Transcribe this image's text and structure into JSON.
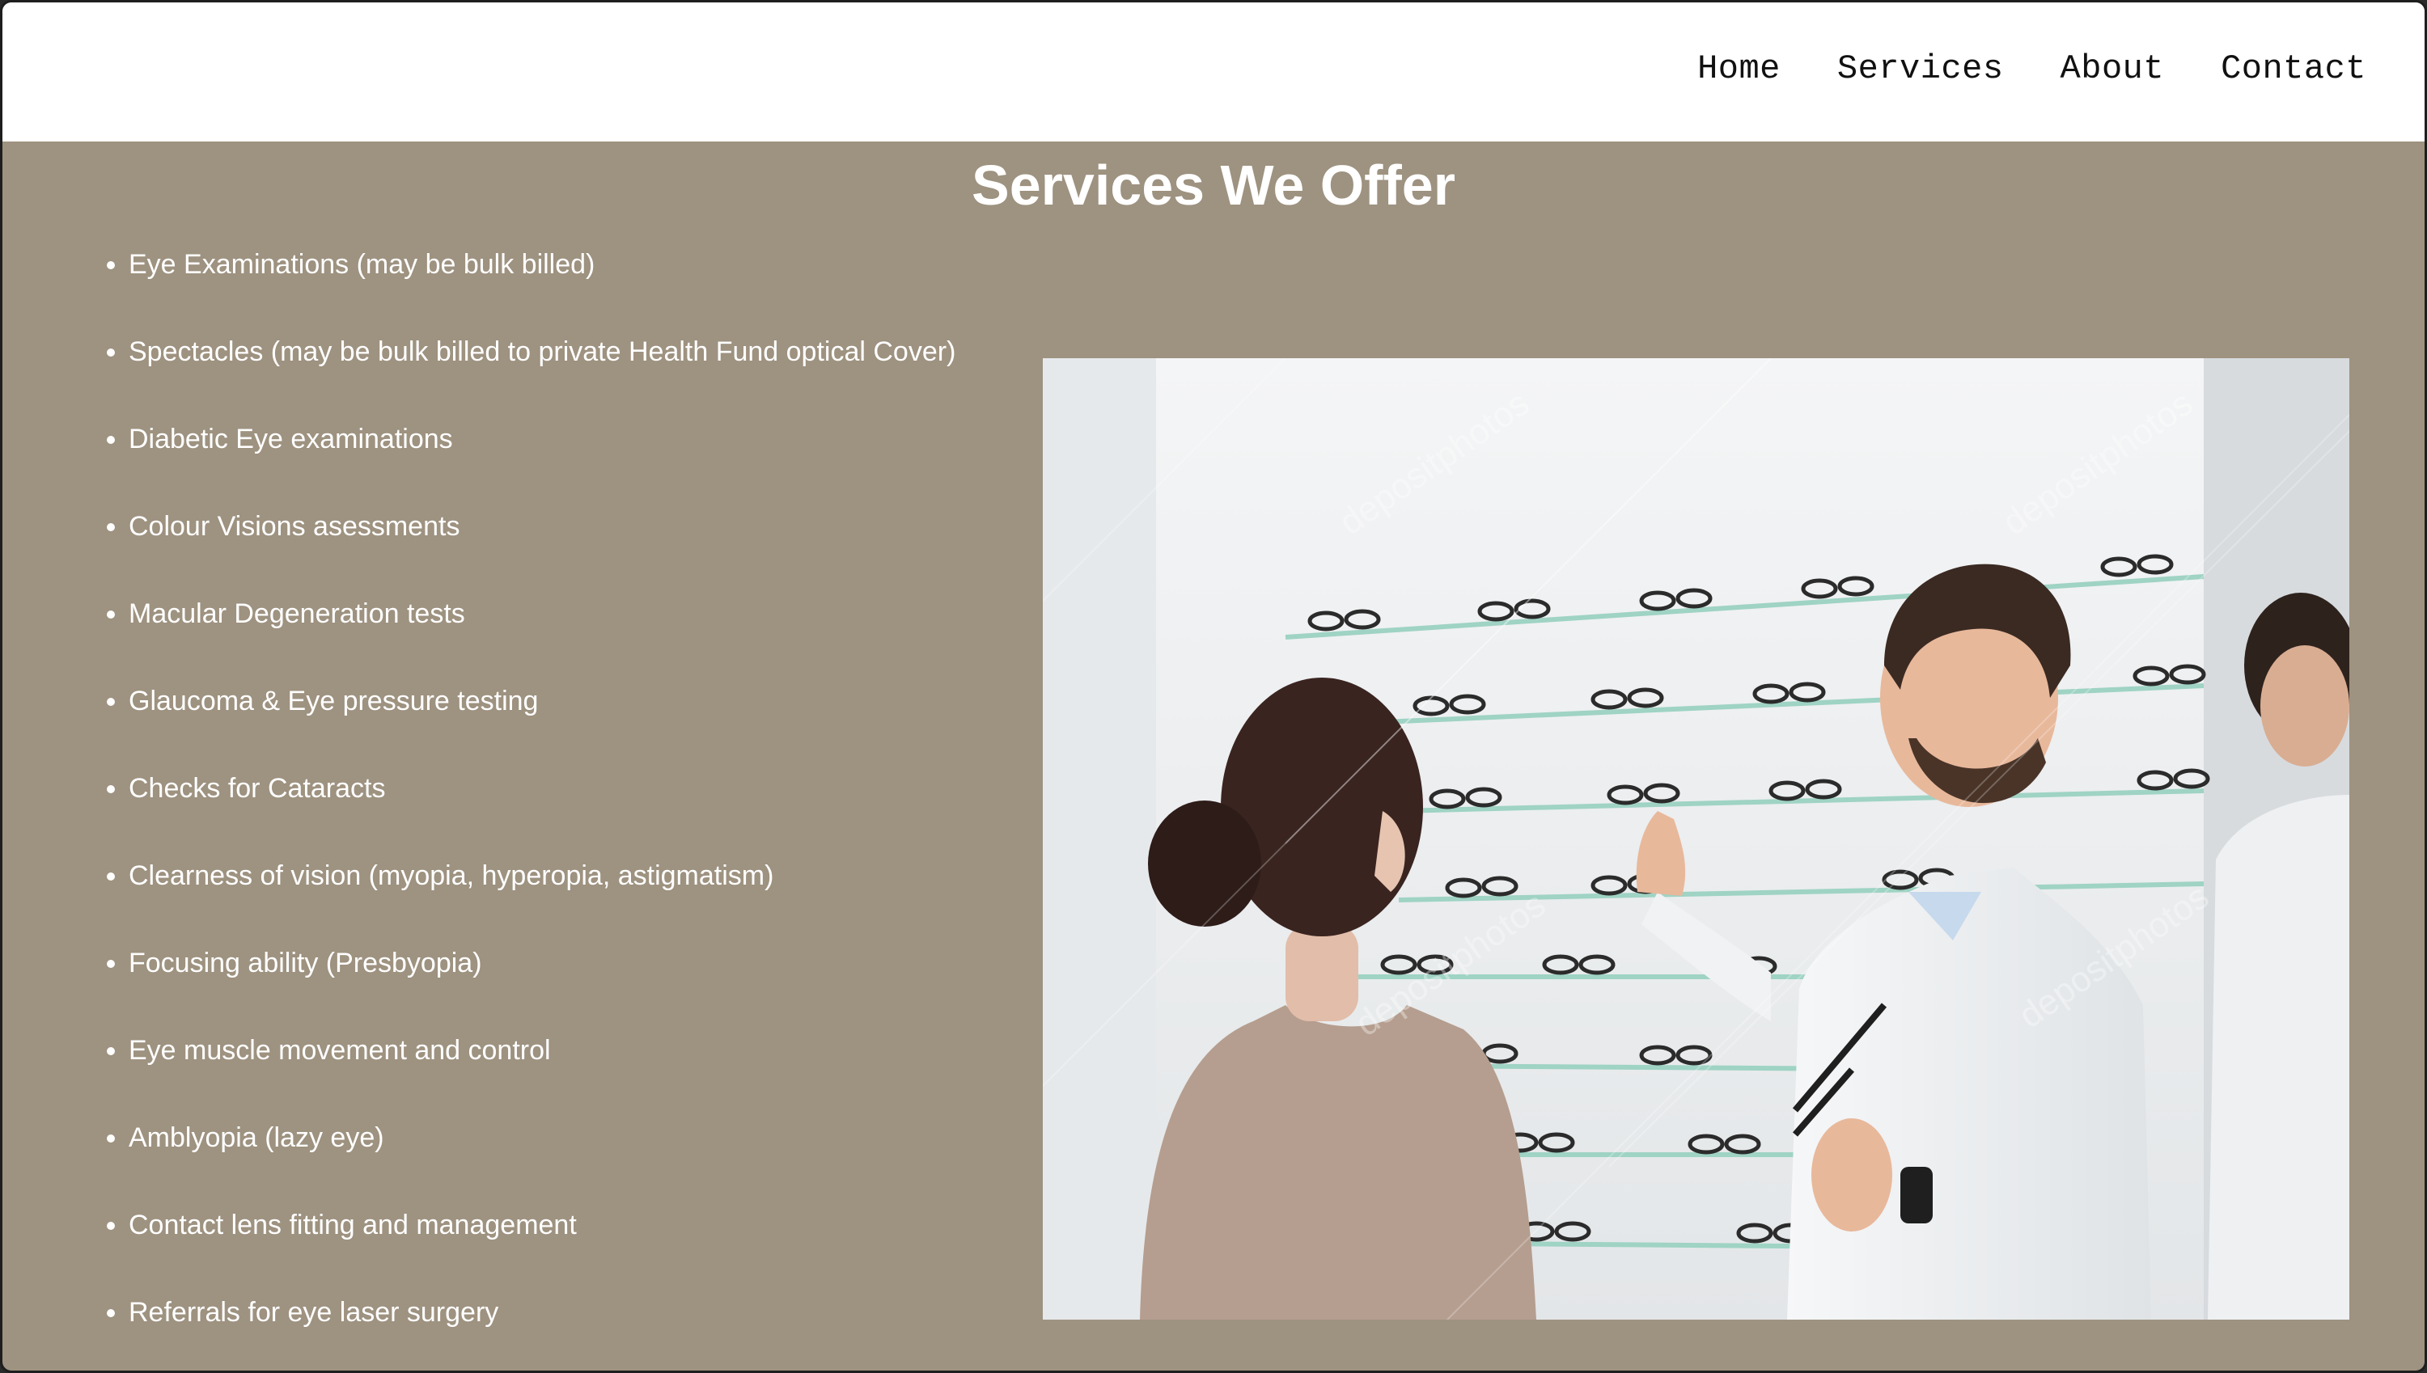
{
  "nav": {
    "links": [
      "Home",
      "Services",
      "About",
      "Contact"
    ]
  },
  "page": {
    "title": "Services We Offer"
  },
  "services": [
    "Eye Examinations (may be bulk billed)",
    "Spectacles (may be bulk billed to private Health Fund optical Cover)",
    "Diabetic Eye examinations",
    "Colour Visions asessments",
    "Macular Degeneration tests",
    "Glaucoma & Eye pressure testing",
    "Checks for Cataracts",
    "Clearness of vision (myopia, hyperopia, astigmatism)",
    "Focusing ability (Presbyopia)",
    "Eye muscle movement and control",
    "Amblyopia (lazy eye)",
    "Contact lens fitting and management",
    "Referrals for eye laser surgery"
  ],
  "colors": {
    "background": "#9e9280",
    "nav_background": "#ffffff",
    "text": "#ffffff"
  },
  "image": {
    "watermark": "depositphotos"
  }
}
